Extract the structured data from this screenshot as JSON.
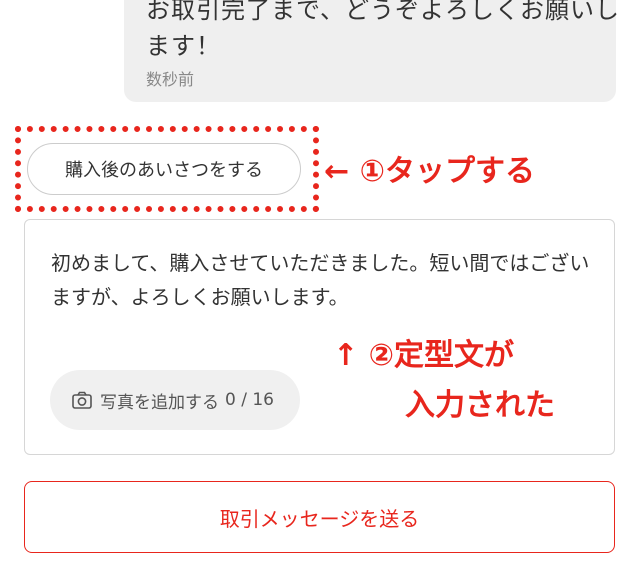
{
  "chat": {
    "line1": "お取引完了まで、どうぞよろしくお願いし",
    "line2": "ます！",
    "timestamp": "数秒前"
  },
  "greeting_button": {
    "label": "購入後のあいさつをする"
  },
  "annotations": {
    "step1": "← ①タップする",
    "step2_line1": "↑ ②定型文が",
    "step2_line2": "入力された"
  },
  "message": {
    "text": "初めまして、購入させていただきました。短い間ではございますが、よろしくお願いします。"
  },
  "photo": {
    "label": "写真を追加する",
    "counter": "0 / 16"
  },
  "send_button": {
    "label": "取引メッセージを送る"
  },
  "colors": {
    "accent_red": "#e8261d",
    "bubble_gray": "#efefef",
    "border_gray": "#d6d6d6"
  },
  "icons": {
    "photo": "camera-icon"
  }
}
